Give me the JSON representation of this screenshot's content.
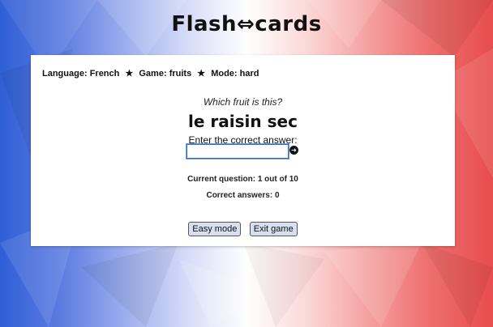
{
  "app": {
    "title": "Flash⇔cards"
  },
  "game_info": {
    "language_label": "Language:",
    "language": "French",
    "game_label": "Game:",
    "game": "fruits",
    "mode_label": "Mode:",
    "mode": "hard",
    "separator": "★"
  },
  "question": {
    "prompt": "Which fruit is this?",
    "word": "le raisin sec",
    "instruction": "Enter the correct answer:",
    "answer_value": ""
  },
  "stats": {
    "current_question": "Current question: 1 out of 10",
    "correct_answers": "Correct answers: 0"
  },
  "buttons": {
    "easy_mode": "Easy mode",
    "exit_game": "Exit game"
  },
  "colors": {
    "blue": "#2f5fd6",
    "red": "#e84d4d",
    "white": "#ffffff"
  },
  "icons": {
    "submit": "arrow-right-circle-icon"
  }
}
